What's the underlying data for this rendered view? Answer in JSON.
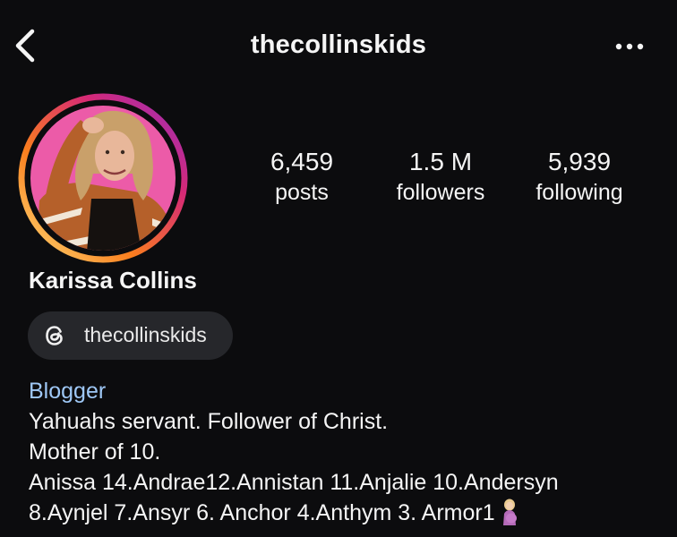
{
  "header": {
    "username": "thecollinskids",
    "back_icon": "chevron-left-icon",
    "more_icon": "more-horizontal-icon"
  },
  "profile": {
    "display_name": "Karissa Collins",
    "avatar_ring_colors": [
      "#feda75",
      "#fa7e1e",
      "#d62976",
      "#962fbf"
    ],
    "avatar_bg": "#ec5ba8"
  },
  "stats": {
    "posts": {
      "value": "6,459",
      "label": "posts"
    },
    "followers": {
      "value": "1.5 M",
      "label": "followers"
    },
    "following": {
      "value": "5,939",
      "label": "following"
    }
  },
  "threads": {
    "label": "thecollinskids",
    "icon": "threads-icon"
  },
  "bio": {
    "category": "Blogger",
    "lines": [
      "Yahuahs servant. Follower of Christ.",
      "Mother of 10.",
      "Anissa 14.Andrae12.Annistan 11.Anjalie 10.Andersyn",
      "8.Aynjel 7.Ansyr 6. Anchor 4.Anthym 3. Armor1"
    ],
    "trailing_emoji": "pregnant-woman-emoji",
    "category_color": "#9fc8f6"
  }
}
